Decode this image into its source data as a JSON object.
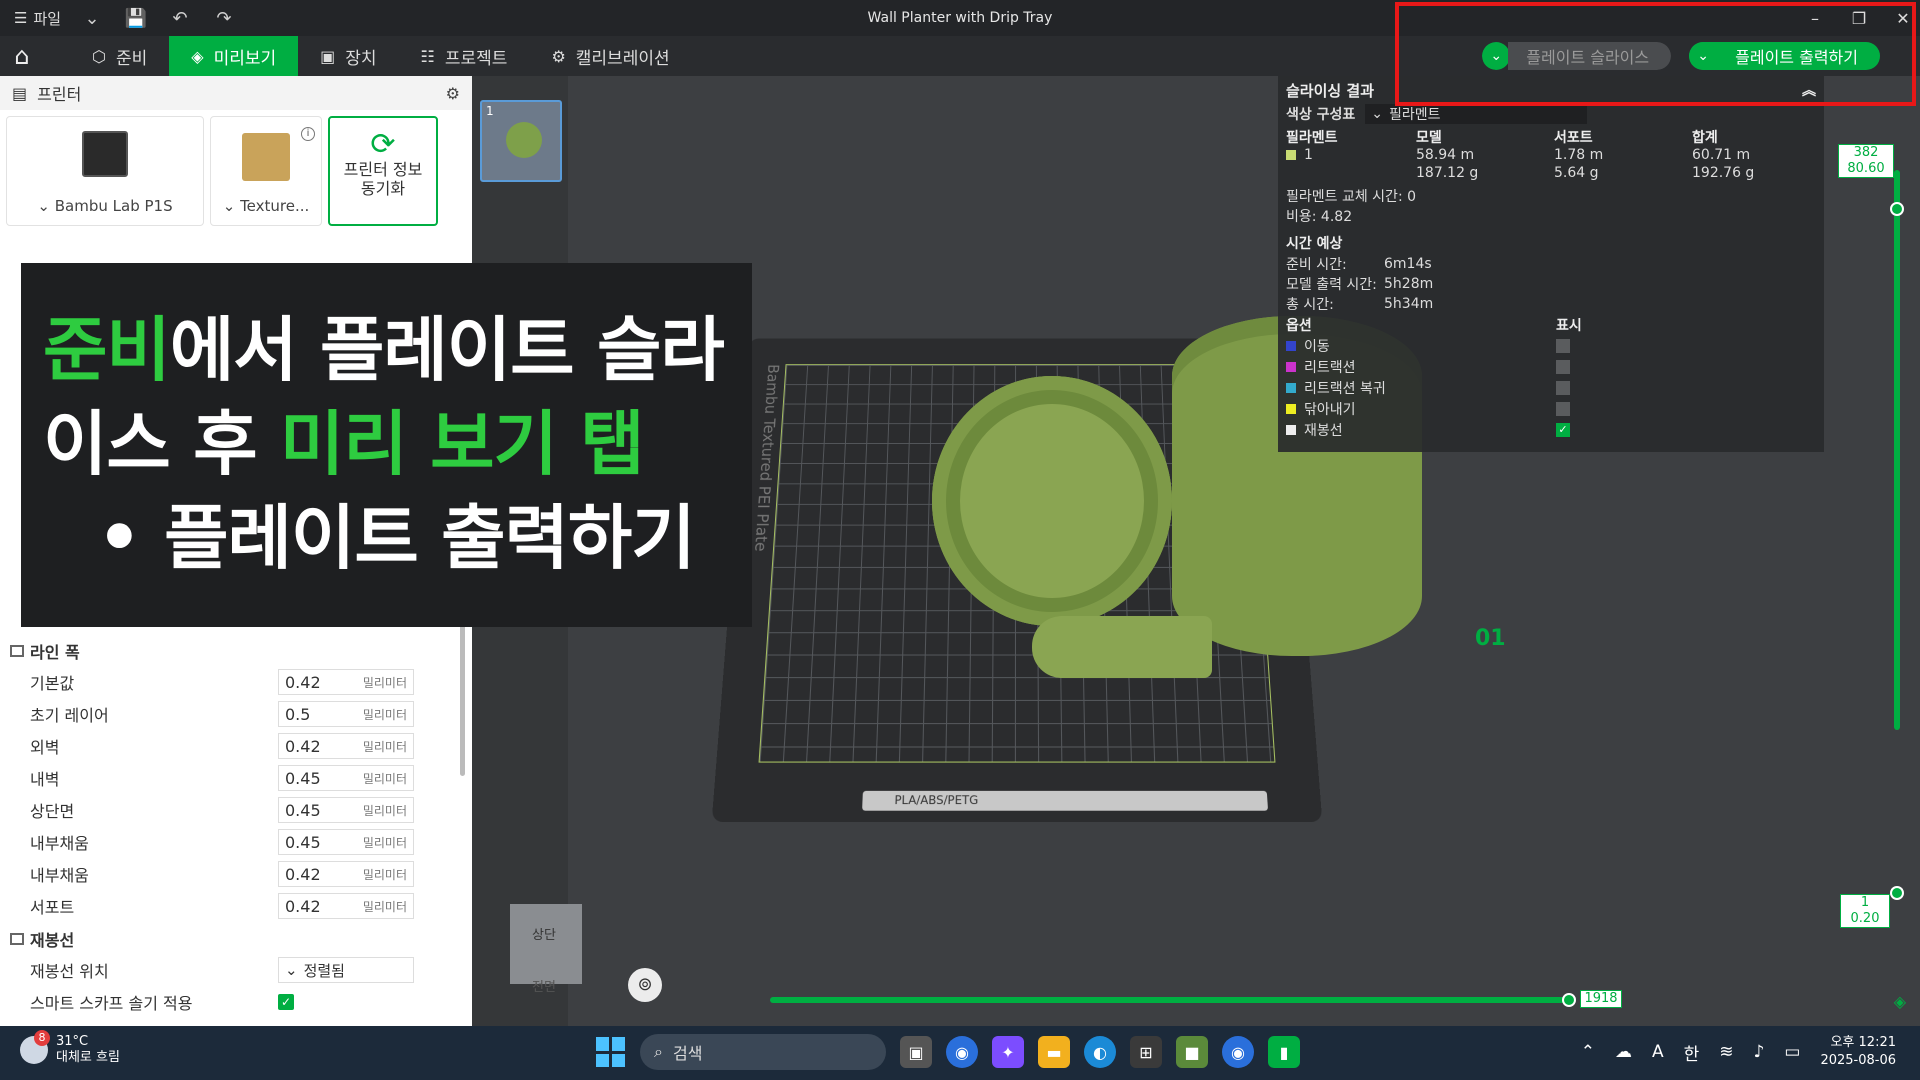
{
  "titlebar": {
    "file_menu": "파일",
    "title": "Wall Planter with Drip Tray",
    "icons": [
      "menu-icon",
      "chevron-down-icon",
      "save-icon",
      "undo-icon",
      "redo-icon"
    ],
    "window_controls": [
      "minimize-icon",
      "restore-icon",
      "close-icon"
    ]
  },
  "tabs": [
    {
      "label": "준비",
      "icon": "cube-icon"
    },
    {
      "label": "미리보기",
      "icon": "layers-icon",
      "active": true
    },
    {
      "label": "장치",
      "icon": "device-icon"
    },
    {
      "label": "프로젝트",
      "icon": "project-icon"
    },
    {
      "label": "캘리브레이션",
      "icon": "calibration-icon"
    }
  ],
  "actions": {
    "slice_label": "플레이트 슬라이스",
    "print_label": "플레이트 출력하기",
    "accent": "#00ae42"
  },
  "left_panel": {
    "printer_header": "프린터",
    "printer_name": "Bambu Lab P1S",
    "plate_name": "Texture...",
    "sync_label": "프린터 정보 동기화",
    "line_width": {
      "title": "라인 폭",
      "rows": [
        {
          "label": "기본값",
          "value": "0.42",
          "unit": "밀리미터"
        },
        {
          "label": "초기 레이어",
          "value": "0.5",
          "unit": "밀리미터"
        },
        {
          "label": "외벽",
          "value": "0.42",
          "unit": "밀리미터"
        },
        {
          "label": "내벽",
          "value": "0.45",
          "unit": "밀리미터"
        },
        {
          "label": "상단면",
          "value": "0.45",
          "unit": "밀리미터"
        },
        {
          "label": "내부채움",
          "value": "0.45",
          "unit": "밀리미터"
        },
        {
          "label": "내부채움",
          "value": "0.42",
          "unit": "밀리미터"
        },
        {
          "label": "서포트",
          "value": "0.42",
          "unit": "밀리미터"
        }
      ]
    },
    "seam": {
      "title": "재봉선",
      "position_label": "재봉선 위치",
      "position_value": "정렬됨",
      "smart_label": "스마트 스카프 솔기 적용"
    }
  },
  "caption": {
    "line1_green": "준비",
    "line1_rest": "에서 플레이트 슬라",
    "line2_white": "이스 후 ",
    "line2_green": "미리 보기 탭",
    "line3": "플레이트 출력하기"
  },
  "results": {
    "title": "슬라이싱 결과",
    "color_scheme_label": "색상 구성표",
    "color_scheme_value": "필라멘트",
    "headers": [
      "필라멘트",
      "모델",
      "서포트",
      "합계"
    ],
    "filament_row": {
      "id": "1",
      "model_m": "58.94 m",
      "model_g": "187.12 g",
      "support_m": "1.78 m",
      "support_g": "5.64 g",
      "total_m": "60.71 m",
      "total_g": "192.76 g",
      "color": "#c9dc74"
    },
    "change_time": "필라멘트 교체 시간: 0",
    "cost": "비용: 4.82",
    "time_title": "시간 예상",
    "prep_label": "준비 시간:",
    "prep_value": "6m14s",
    "model_time_label": "모델 출력 시간:",
    "model_time_value": "5h28m",
    "total_time_label": "총 시간:",
    "total_time_value": "5h34m",
    "options_header": "옵션",
    "visible_header": "표시",
    "options": [
      {
        "name": "이동",
        "color": "#3344cc",
        "visible": false
      },
      {
        "name": "리트랙션",
        "color": "#cc33cc",
        "visible": false
      },
      {
        "name": "리트랙션 복귀",
        "color": "#33aacc",
        "visible": false
      },
      {
        "name": "닦아내기",
        "color": "#eeee22",
        "visible": false
      },
      {
        "name": "재봉선",
        "color": "#eeeeee",
        "visible": true
      }
    ]
  },
  "viewport": {
    "plate_number": "01",
    "bed_text": "Bambu Textured PEI Plate",
    "bed_label": "PLA/ABS/PETG",
    "layer_top_num": "382",
    "layer_top_height": "80.60",
    "layer_bottom_num": "1",
    "layer_bottom_height": "0.20",
    "horizontal_value": "1918",
    "view_top": "상단",
    "view_front": "전면"
  },
  "taskbar": {
    "badge": "8",
    "temp": "31°C",
    "weather": "대체로 흐림",
    "search": "검색",
    "ime_a": "A",
    "ime_han": "한",
    "time": "오후 12:21",
    "date": "2025-08-06"
  }
}
